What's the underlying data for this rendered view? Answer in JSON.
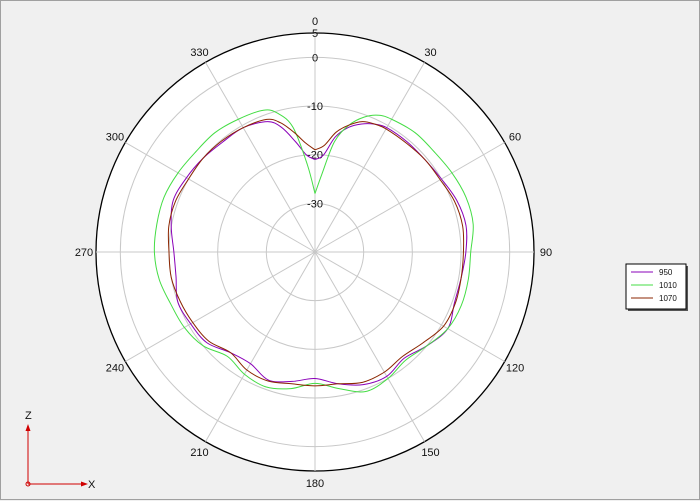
{
  "chart_data": {
    "type": "polar-line",
    "title": "",
    "angle_labels": [
      "0",
      "30",
      "60",
      "90",
      "120",
      "150",
      "180",
      "210",
      "240",
      "270",
      "300",
      "330"
    ],
    "radial_labels": [
      "5",
      "0",
      "-10",
      "-20",
      "-30"
    ],
    "radial_range": [
      -40,
      5
    ],
    "radial_ticks": [
      -30,
      -20,
      -10,
      0
    ],
    "grid": true,
    "legend_position": "right",
    "series": [
      {
        "name": "950",
        "color": "#8a00b8",
        "points": [
          [
            0,
            -21
          ],
          [
            5,
            -20
          ],
          [
            10,
            -16
          ],
          [
            15,
            -13.5
          ],
          [
            20,
            -12
          ],
          [
            25,
            -11
          ],
          [
            30,
            -10.5
          ],
          [
            40,
            -10.5
          ],
          [
            50,
            -10.5
          ],
          [
            60,
            -10
          ],
          [
            70,
            -9
          ],
          [
            80,
            -8.5
          ],
          [
            90,
            -9
          ],
          [
            100,
            -9.5
          ],
          [
            110,
            -9.5
          ],
          [
            120,
            -8.5
          ],
          [
            130,
            -10
          ],
          [
            140,
            -11.5
          ],
          [
            150,
            -10.5
          ],
          [
            160,
            -11
          ],
          [
            170,
            -12.5
          ],
          [
            180,
            -14
          ],
          [
            190,
            -13
          ],
          [
            200,
            -12
          ],
          [
            210,
            -13.5
          ],
          [
            220,
            -13
          ],
          [
            230,
            -11
          ],
          [
            240,
            -10.5
          ],
          [
            250,
            -10
          ],
          [
            260,
            -11
          ],
          [
            270,
            -11
          ],
          [
            280,
            -10
          ],
          [
            290,
            -9
          ],
          [
            300,
            -9.5
          ],
          [
            310,
            -10
          ],
          [
            320,
            -10.5
          ],
          [
            330,
            -10.5
          ],
          [
            340,
            -11.5
          ],
          [
            345,
            -13.5
          ],
          [
            350,
            -17
          ],
          [
            355,
            -20
          ],
          [
            360,
            -21
          ]
        ]
      },
      {
        "name": "1010",
        "color": "#44dd44",
        "points": [
          [
            0,
            -28
          ],
          [
            5,
            -24
          ],
          [
            10,
            -17
          ],
          [
            15,
            -13
          ],
          [
            20,
            -10.5
          ],
          [
            25,
            -9
          ],
          [
            30,
            -8.5
          ],
          [
            40,
            -8
          ],
          [
            50,
            -8
          ],
          [
            60,
            -7.5
          ],
          [
            70,
            -7
          ],
          [
            80,
            -7
          ],
          [
            90,
            -8
          ],
          [
            100,
            -8
          ],
          [
            110,
            -8
          ],
          [
            120,
            -8.5
          ],
          [
            130,
            -10
          ],
          [
            140,
            -11
          ],
          [
            150,
            -10
          ],
          [
            160,
            -9.5
          ],
          [
            170,
            -11.5
          ],
          [
            180,
            -13
          ],
          [
            190,
            -11.5
          ],
          [
            200,
            -10.5
          ],
          [
            210,
            -11
          ],
          [
            220,
            -12
          ],
          [
            230,
            -10
          ],
          [
            240,
            -9
          ],
          [
            250,
            -8.5
          ],
          [
            260,
            -7.5
          ],
          [
            270,
            -7
          ],
          [
            280,
            -7
          ],
          [
            290,
            -7
          ],
          [
            300,
            -7.5
          ],
          [
            310,
            -8
          ],
          [
            320,
            -8
          ],
          [
            330,
            -8.5
          ],
          [
            340,
            -9
          ],
          [
            345,
            -10.5
          ],
          [
            350,
            -14
          ],
          [
            355,
            -22
          ],
          [
            360,
            -28
          ]
        ]
      },
      {
        "name": "1070",
        "color": "#8b2500",
        "points": [
          [
            0,
            -19
          ],
          [
            5,
            -18
          ],
          [
            10,
            -15
          ],
          [
            15,
            -13
          ],
          [
            20,
            -11.5
          ],
          [
            25,
            -11
          ],
          [
            30,
            -10.8
          ],
          [
            40,
            -10.8
          ],
          [
            50,
            -10.5
          ],
          [
            60,
            -10.3
          ],
          [
            70,
            -9.5
          ],
          [
            80,
            -9.2
          ],
          [
            90,
            -9.5
          ],
          [
            100,
            -9.5
          ],
          [
            110,
            -9.3
          ],
          [
            120,
            -9.5
          ],
          [
            130,
            -11
          ],
          [
            140,
            -12
          ],
          [
            150,
            -11.5
          ],
          [
            160,
            -11.5
          ],
          [
            170,
            -12.5
          ],
          [
            180,
            -12.5
          ],
          [
            190,
            -12.5
          ],
          [
            200,
            -11.8
          ],
          [
            210,
            -12
          ],
          [
            220,
            -13
          ],
          [
            230,
            -11.5
          ],
          [
            240,
            -11
          ],
          [
            250,
            -10.5
          ],
          [
            260,
            -10
          ],
          [
            270,
            -10
          ],
          [
            280,
            -9.5
          ],
          [
            290,
            -9.5
          ],
          [
            300,
            -10
          ],
          [
            310,
            -10
          ],
          [
            320,
            -10.2
          ],
          [
            330,
            -10.5
          ],
          [
            340,
            -11
          ],
          [
            345,
            -12.5
          ],
          [
            350,
            -15
          ],
          [
            355,
            -17.5
          ],
          [
            360,
            -19
          ]
        ]
      }
    ]
  },
  "axis_indicator": {
    "z_label": "Z",
    "x_label": "X",
    "color": "#d00000"
  }
}
